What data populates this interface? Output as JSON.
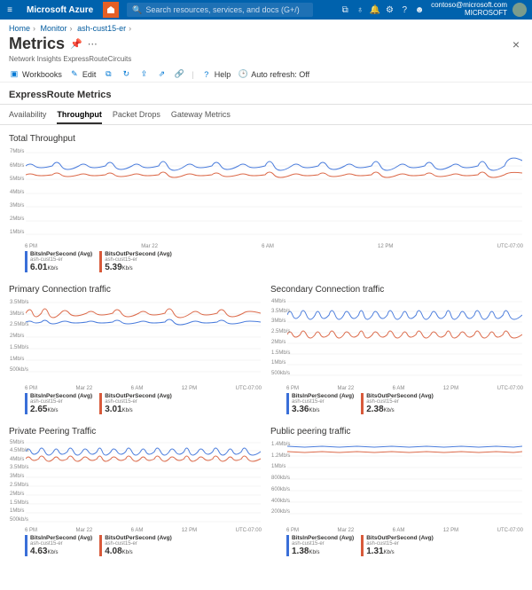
{
  "topbar": {
    "brand": "Microsoft Azure",
    "search_placeholder": "Search resources, services, and docs (G+/)",
    "account_email": "contoso@microsoft.com",
    "account_org": "MICROSOFT"
  },
  "breadcrumbs": [
    "Home",
    "Monitor",
    "ash-cust15-er"
  ],
  "page": {
    "title": "Metrics",
    "subtitle": "Network Insights ExpressRouteCircuits"
  },
  "toolbar": {
    "workbooks": "Workbooks",
    "edit": "Edit",
    "help": "Help",
    "auto_refresh": "Auto refresh: Off"
  },
  "section_title": "ExpressRoute Metrics",
  "tabs": [
    "Availability",
    "Throughput",
    "Packet Drops",
    "Gateway Metrics"
  ],
  "tabs_active_index": 1,
  "timezone": "UTC-07:00",
  "xaxis_ticks": [
    "6 PM",
    "Mar 22",
    "6 AM",
    "12 PM"
  ],
  "charts": {
    "total": {
      "title": "Total Throughput",
      "yaxis": [
        "7Mb/s",
        "6Mb/s",
        "5Mb/s",
        "4Mb/s",
        "3Mb/s",
        "2Mb/s",
        "1Mb/s"
      ],
      "legend": [
        {
          "color": "blue",
          "name": "BitsInPerSecond (Avg)",
          "src": "ash-cust15-er",
          "val": "6.01",
          "unit": "Kb/s"
        },
        {
          "color": "red",
          "name": "BitsOutPerSecond (Avg)",
          "src": "ash-cust15-er",
          "val": "5.39",
          "unit": "Kb/s"
        }
      ]
    },
    "primary": {
      "title": "Primary Connection traffic",
      "yaxis": [
        "3.5Mb/s",
        "3Mb/s",
        "2.5Mb/s",
        "2Mb/s",
        "1.5Mb/s",
        "1Mb/s",
        "500kb/s"
      ],
      "legend": [
        {
          "color": "blue",
          "name": "BitsInPerSecond (Avg)",
          "src": "ash-cust15-er",
          "val": "2.65",
          "unit": "Kb/s"
        },
        {
          "color": "red",
          "name": "BitsOutPerSecond (Avg)",
          "src": "ash-cust15-er",
          "val": "3.01",
          "unit": "Kb/s"
        }
      ]
    },
    "secondary": {
      "title": "Secondary Connection traffic",
      "yaxis": [
        "4Mb/s",
        "3.5Mb/s",
        "3Mb/s",
        "2.5Mb/s",
        "2Mb/s",
        "1.5Mb/s",
        "1Mb/s",
        "500kb/s"
      ],
      "legend": [
        {
          "color": "blue",
          "name": "BitsInPerSecond (Avg)",
          "src": "ash-cust15-er",
          "val": "3.36",
          "unit": "Kb/s"
        },
        {
          "color": "red",
          "name": "BitsOutPerSecond (Avg)",
          "src": "ash-cust15-er",
          "val": "2.38",
          "unit": "Kb/s"
        }
      ]
    },
    "private": {
      "title": "Private Peering Traffic",
      "yaxis": [
        "5Mb/s",
        "4.5Mb/s",
        "4Mb/s",
        "3.5Mb/s",
        "3Mb/s",
        "2.5Mb/s",
        "2Mb/s",
        "1.5Mb/s",
        "1Mb/s",
        "500kb/s"
      ],
      "legend": [
        {
          "color": "blue",
          "name": "BitsInPerSecond (Avg)",
          "src": "ash-cust15-er",
          "val": "4.63",
          "unit": "Kb/s"
        },
        {
          "color": "red",
          "name": "BitsOutPerSecond (Avg)",
          "src": "ash-cust15-er",
          "val": "4.08",
          "unit": "Kb/s"
        }
      ]
    },
    "public": {
      "title": "Public peering traffic",
      "yaxis": [
        "1.4Mb/s",
        "1.2Mb/s",
        "1Mb/s",
        "800kb/s",
        "600kb/s",
        "400kb/s",
        "200kb/s"
      ],
      "legend": [
        {
          "color": "blue",
          "name": "BitsInPerSecond (Avg)",
          "src": "ash-cust15-er",
          "val": "1.38",
          "unit": "Kb/s"
        },
        {
          "color": "red",
          "name": "BitsOutPerSecond (Avg)",
          "src": "ash-cust15-er",
          "val": "1.31",
          "unit": "Kb/s"
        }
      ]
    }
  },
  "chart_data": [
    {
      "type": "line",
      "title": "Total Throughput",
      "xlabel": "",
      "ylabel": "",
      "ylim": [
        0,
        7000000
      ],
      "x_range": [
        "Mar 21 6PM",
        "Mar 22 6PM"
      ],
      "series": [
        {
          "name": "BitsInPerSecond (Avg)",
          "color": "#4a7cdc",
          "avg_kbps": 6.01,
          "values_mbps_approx": [
            6.0,
            6.2,
            5.9,
            6.5,
            6.0,
            6.3,
            5.9,
            6.6,
            6.0,
            6.2,
            6.0,
            6.7,
            6.0,
            6.2,
            5.9,
            6.5,
            6.0,
            6.3,
            5.9,
            6.6,
            6.0,
            6.2,
            6.0,
            6.8
          ]
        },
        {
          "name": "BitsOutPerSecond (Avg)",
          "color": "#dc6a4a",
          "avg_kbps": 5.39,
          "values_mbps_approx": [
            5.4,
            5.5,
            5.3,
            5.6,
            5.4,
            5.5,
            5.3,
            5.7,
            5.4,
            5.5,
            5.4,
            5.8,
            5.4,
            5.5,
            5.3,
            5.6,
            5.4,
            5.5,
            5.3,
            5.7,
            5.4,
            5.5,
            5.4,
            5.8
          ]
        }
      ]
    },
    {
      "type": "line",
      "title": "Primary Connection traffic",
      "ylim": [
        0,
        3500000
      ],
      "series": [
        {
          "name": "BitsInPerSecond (Avg)",
          "avg_kbps": 2.65,
          "approx_baseline_mbps": 2.6
        },
        {
          "name": "BitsOutPerSecond (Avg)",
          "avg_kbps": 3.01,
          "approx_baseline_mbps": 3.0
        }
      ]
    },
    {
      "type": "line",
      "title": "Secondary Connection traffic",
      "ylim": [
        0,
        4000000
      ],
      "series": [
        {
          "name": "BitsInPerSecond (Avg)",
          "avg_kbps": 3.36,
          "approx_baseline_mbps": 3.3
        },
        {
          "name": "BitsOutPerSecond (Avg)",
          "avg_kbps": 2.38,
          "approx_baseline_mbps": 2.4
        }
      ]
    },
    {
      "type": "line",
      "title": "Private Peering Traffic",
      "ylim": [
        0,
        5000000
      ],
      "series": [
        {
          "name": "BitsInPerSecond (Avg)",
          "avg_kbps": 4.63,
          "approx_baseline_mbps": 4.6
        },
        {
          "name": "BitsOutPerSecond (Avg)",
          "avg_kbps": 4.08,
          "approx_baseline_mbps": 4.1
        }
      ]
    },
    {
      "type": "line",
      "title": "Public peering traffic",
      "ylim": [
        0,
        1400000
      ],
      "series": [
        {
          "name": "BitsInPerSecond (Avg)",
          "avg_kbps": 1.38,
          "approx_baseline_mbps": 1.38
        },
        {
          "name": "BitsOutPerSecond (Avg)",
          "avg_kbps": 1.31,
          "approx_baseline_mbps": 1.31
        }
      ]
    }
  ]
}
